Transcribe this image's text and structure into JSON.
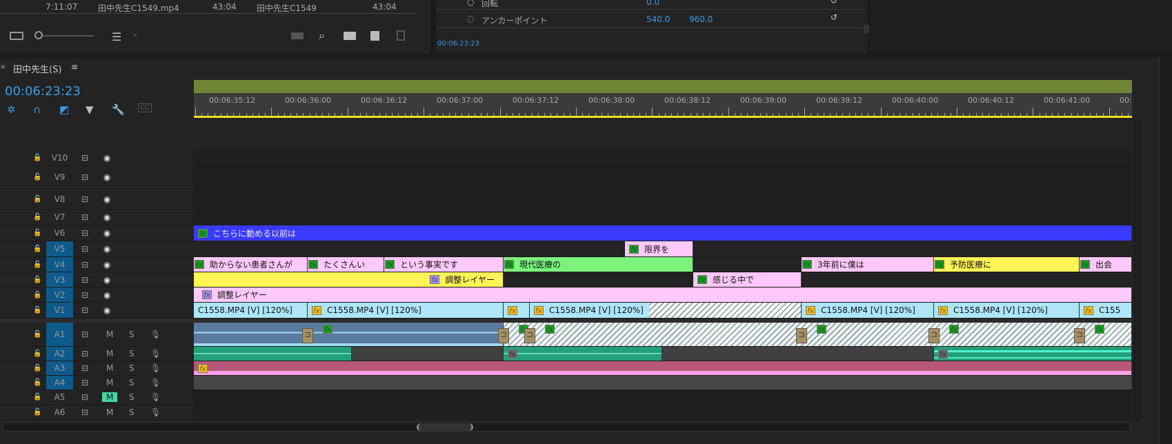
{
  "project_panel": {
    "row": [
      "7:11:07",
      "田中先生C1549.mp4",
      "43:04",
      "田中先生C1549",
      "43:04"
    ],
    "toolbar_icons": [
      "list-view-icon",
      "zoom-slider",
      "sort-icon",
      "chevron-down-icon",
      "automate-icon",
      "search-icon",
      "new-bin-icon",
      "new-item-icon",
      "trash-icon"
    ]
  },
  "effect_controls": {
    "rows": [
      {
        "label": "回転",
        "values": [
          "0.0"
        ]
      },
      {
        "label": "アンカーポイント",
        "values": [
          "540.0",
          "960.0"
        ]
      }
    ],
    "timecode": "00:06:23:23"
  },
  "timeline": {
    "tab": "田中先生(S)",
    "timecode": "00:06:23:23",
    "ruler": [
      "00:06:35:12",
      "00:06:36:00",
      "00:06:36:12",
      "00:06:37:00",
      "00:06:37:12",
      "00:06:38:00",
      "00:06:38:12",
      "00:06:39:00",
      "00:06:39:12",
      "00:06:40:00",
      "00:06:40:12",
      "00:06:41:00",
      "00:"
    ],
    "tools": [
      "snap-icon",
      "linked-selection-icon",
      "insert-icon",
      "add-marker-icon",
      "settings-wrench-icon",
      "captions-icon"
    ],
    "video_tracks": [
      "V10",
      "V9",
      "V8",
      "V7",
      "V6",
      "V5",
      "V4",
      "V3",
      "V2",
      "V1"
    ],
    "audio_tracks": [
      "A1",
      "A2",
      "A3",
      "A4",
      "A5",
      "A6"
    ],
    "targeted": [
      "V5",
      "V4",
      "V3",
      "V2",
      "V1",
      "A1",
      "A2",
      "A3",
      "A4"
    ],
    "mute_on": [
      "A5"
    ],
    "mute_label": "M",
    "solo_label": "S",
    "clips": {
      "V6": [
        "こちらに動める以前は"
      ],
      "V5": [
        "限界を"
      ],
      "V4": [
        "助からない患者さんが",
        "たくさんい",
        "という事実です",
        "現代医療の",
        "3年前に僕は",
        "予防医療に",
        "出会"
      ],
      "V3": [
        "調整レイヤー",
        "感じる中で"
      ],
      "V2": [
        "調整レイヤー"
      ],
      "V1": [
        "C1558.MP4 [V] [120%]",
        "C1558.MP4 [V] [120%]",
        "",
        "C1558.MP4 [V] [120%]",
        "C1558.MP4 [V] [120%]",
        "C1558.MP4 [V] [120%]",
        "C155"
      ]
    },
    "colors": {
      "title_blue": "#3a3aff",
      "pink": "#ffc8fa",
      "green": "#7cf47c",
      "yellow": "#fff455",
      "video": "#aee6f8",
      "audio_blue": "#5a7aa0",
      "audio_green": "#23a07a",
      "audio_pink": "#b85878",
      "work_area": "#6f8535",
      "playhead": "#f0e020"
    }
  }
}
